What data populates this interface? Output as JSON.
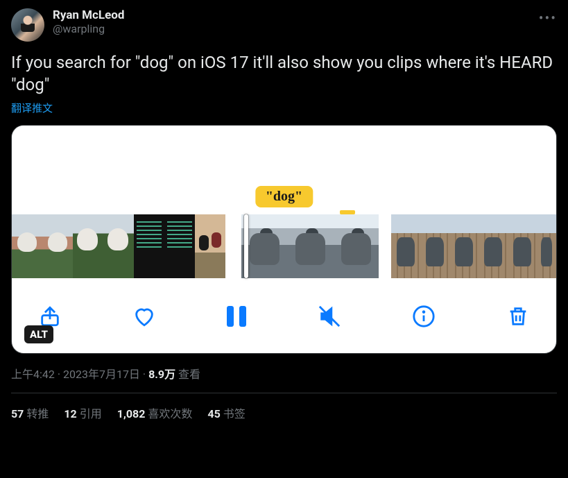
{
  "author": {
    "display_name": "Ryan McLeod",
    "handle": "@warpling"
  },
  "tweet_text": "If you search for \"dog\" on iOS 17 it'll also show you clips where it's HEARD \"dog\"",
  "translate_label": "翻译推文",
  "media": {
    "search_tag": "\"dog\"",
    "alt_badge": "ALT",
    "toolbar": {
      "share": "share",
      "like": "like",
      "pause": "pause",
      "mute": "mute",
      "info": "info",
      "delete": "delete"
    }
  },
  "meta": {
    "time": "上午4:42",
    "date": "2023年7月17日",
    "views_count": "8.9万",
    "views_label": "查看"
  },
  "stats": {
    "retweets_count": "57",
    "retweets_label": "转推",
    "quotes_count": "12",
    "quotes_label": "引用",
    "likes_count": "1,082",
    "likes_label": "喜欢次数",
    "bookmarks_count": "45",
    "bookmarks_label": "书签"
  }
}
